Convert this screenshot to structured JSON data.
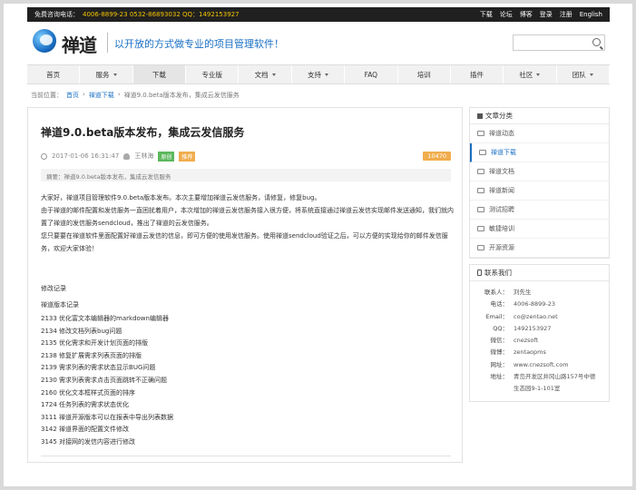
{
  "topbar": {
    "hotline_label": "免费咨询电话：",
    "hotline": "4006-8899-23 0532-86893032 QQ：1492153927",
    "links": [
      "下载",
      "论坛",
      "博客",
      "登录",
      "注册",
      "English"
    ]
  },
  "header": {
    "brand": "禅道",
    "slogan": "以开放的方式做专业的项目管理软件！"
  },
  "nav": [
    "首页",
    "服务",
    "下载",
    "专业版",
    "文档",
    "支持",
    "FAQ",
    "培训",
    "插件",
    "社区",
    "团队"
  ],
  "breadcrumb": {
    "label": "当前位置：",
    "items": [
      "首页",
      "禅道下载",
      "禅道9.0.beta版本发布，集成云发信服务"
    ]
  },
  "article": {
    "title": "禅道9.0.beta版本发布，集成云发信服务",
    "date": "2017-01-06 16:31:47",
    "author": "王林海",
    "tag": "原创",
    "action": "推荐",
    "views": "10470",
    "summary": "摘要：禅道9.0.beta版本发布，集成云发信服务",
    "paragraphs": [
      "大家好，禅道项目管理软件9.0.beta版本发布。本次主要增加禅道云发信服务，请修复，修复bug。",
      "由于禅道的邮件配置和发信服务一直困扰着用户，本次增加的禅道云发信服务接入很方便，将系统直接通过禅道云发信实现邮件发送通知，我们就内置了禅道的发信服务sendcloud，推出了禅道的云发信服务。",
      "您只要要在禅道软件里面配置好禅道云发信的信息，即可方便的使用发信服务。使用禅道sendcloud验证之后，可以方便的实现给你的邮件发信服务，欢迎大家体验！"
    ],
    "section_label": "修改记录",
    "section_sub": "禅道版本记录",
    "changelog": [
      "2133  优化富文本编辑器的markdown编辑器",
      "2134  修改文档列表bug问题",
      "2135  优化需求和开发计划页面的排版",
      "2138  修复扩展需求列表页面的排版",
      "2139  需求列表的需求状态显示BUG问题",
      "2130  需求列表需求点击页面跳转不正确问题",
      "2160  优化文本框样式页面的排序",
      "1724  任务列表的需求状态优化",
      "3111  禅道开源版本可以在报表中导出列表数据",
      "3142  禅道界面的配置文件修改",
      "3145  对接网的发信内容进行修改"
    ]
  },
  "sidebar": {
    "cat_title": "文章分类",
    "categories": [
      "禅道动态",
      "禅道下载",
      "禅道文档",
      "禅道新闻",
      "测试招聘",
      "敏捷培训",
      "开源资源"
    ],
    "active_index": 1,
    "contact_title": "联系我们",
    "contact": [
      {
        "k": "联系人：",
        "v": "刘先生"
      },
      {
        "k": "电话：",
        "v": "4006-8899-23"
      },
      {
        "k": "Email：",
        "v": "co@zentao.net"
      },
      {
        "k": "QQ：",
        "v": "1492153927"
      },
      {
        "k": "微信：",
        "v": "cnezsoft"
      },
      {
        "k": "微博：",
        "v": "zentaopms"
      },
      {
        "k": "网址：",
        "v": "www.cnezsoft.com"
      },
      {
        "k": "地址：",
        "v": "青岛开发区井冈山路157号中德"
      },
      {
        "k": "",
        "v": "生态园9-1-101室"
      }
    ]
  },
  "colors": {
    "accent": "#1a6fc4",
    "hotline": "#f5c400",
    "tag_green": "#5cb85c",
    "badge_orange": "#f0ad4e",
    "topbar_bg": "#202020"
  }
}
